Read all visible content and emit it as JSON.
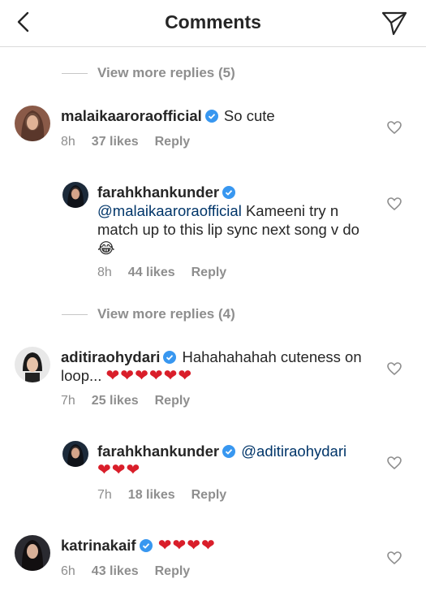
{
  "header": {
    "title": "Comments",
    "back_icon": "chevron-left-icon",
    "send_icon": "paper-plane-icon"
  },
  "view_more_1": "View more replies (5)",
  "view_more_2": "View more replies (4)",
  "comments": [
    {
      "username": "malaikaaroraofficial",
      "text": "So cute",
      "time": "8h",
      "likes": "37 likes",
      "reply": "Reply"
    },
    {
      "username": "farahkhankunder",
      "mention": "@malaikaaroraofficial",
      "text": " Kameeni try n match up to this lip sync next song v do",
      "emoji": "😂",
      "time": "8h",
      "likes": "44 likes",
      "reply": "Reply"
    },
    {
      "username": "aditiraohydari",
      "text": "Hahahahahah cuteness on loop...",
      "hearts": "❤❤❤❤❤❤",
      "time": "7h",
      "likes": "25 likes",
      "reply": "Reply"
    },
    {
      "username": "farahkhankunder",
      "mention": "@aditiraohydari",
      "hearts": "❤❤❤",
      "time": "7h",
      "likes": "18 likes",
      "reply": "Reply"
    },
    {
      "username": "katrinakaif",
      "hearts": "❤❤❤❤",
      "time": "6h",
      "likes": "43 likes",
      "reply": "Reply"
    }
  ],
  "colors": {
    "verified": "#3897f0",
    "heart": "#d91e2a",
    "mention": "#003569",
    "muted": "#8e8e8e"
  }
}
